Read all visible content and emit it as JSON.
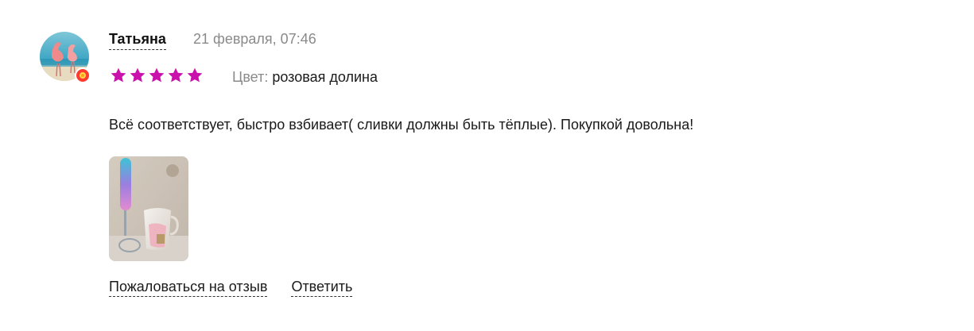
{
  "review": {
    "author": "Татьяна",
    "date": "21 февраля, 07:46",
    "rating": 5,
    "rating_max": 5,
    "star_color": "#cb11ab",
    "color_label": "Цвет:",
    "color_value": "розовая долина",
    "text": "Всё соответствует, быстро взбивает( сливки должны быть тёплые). Покупкой довольна!",
    "photo_count": 1
  },
  "actions": {
    "report_label": "Пожаловаться на отзыв",
    "reply_label": "Ответить"
  }
}
